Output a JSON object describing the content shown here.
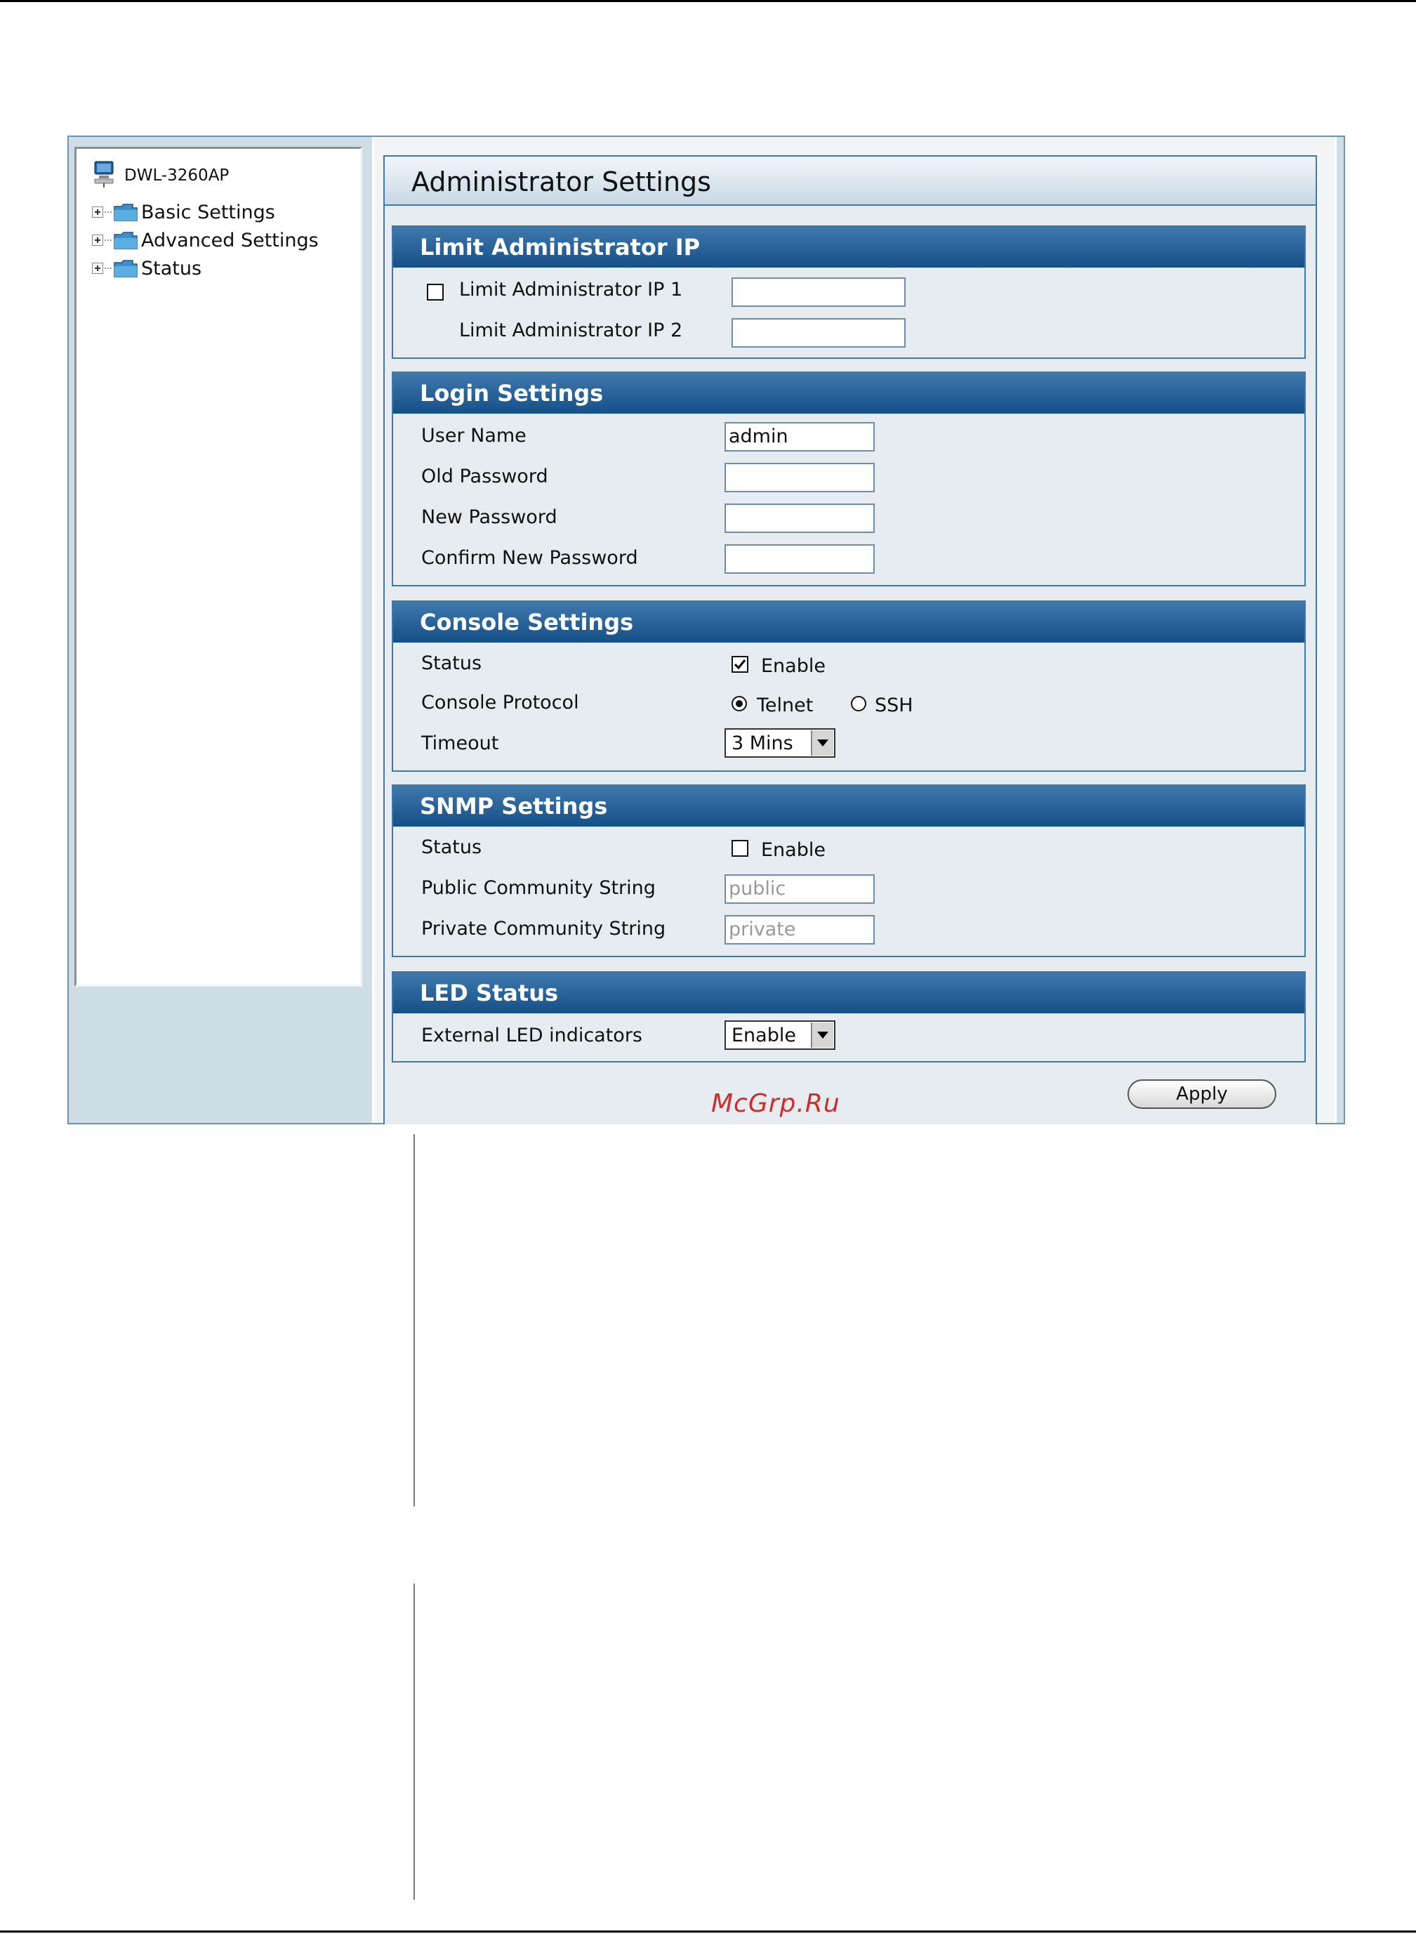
{
  "tree": {
    "root": "DWL-3260AP",
    "items": [
      {
        "label": "Basic Settings"
      },
      {
        "label": "Advanced Settings"
      },
      {
        "label": "Status"
      }
    ]
  },
  "page_title": "Administrator Settings",
  "limit_ip": {
    "heading": "Limit Administrator IP",
    "ip1_label": "Limit Administrator IP 1",
    "ip1_checked": false,
    "ip1_value": "",
    "ip2_label": "Limit Administrator IP 2",
    "ip2_value": ""
  },
  "login": {
    "heading": "Login Settings",
    "user_name_label": "User Name",
    "user_name_value": "admin",
    "old_password_label": "Old Password",
    "new_password_label": "New Password",
    "confirm_password_label": "Confirm New Password"
  },
  "console": {
    "heading": "Console Settings",
    "status_label": "Status",
    "status_enable_label": "Enable",
    "status_enabled": true,
    "protocol_label": "Console Protocol",
    "protocol_options": [
      "Telnet",
      "SSH"
    ],
    "protocol_selected": "Telnet",
    "timeout_label": "Timeout",
    "timeout_value": "3 Mins"
  },
  "snmp": {
    "heading": "SNMP Settings",
    "status_label": "Status",
    "status_enable_label": "Enable",
    "status_enabled": false,
    "public_label": "Public Community String",
    "public_value": "public",
    "private_label": "Private Community String",
    "private_value": "private"
  },
  "led": {
    "heading": "LED Status",
    "external_label": "External LED indicators",
    "external_value": "Enable"
  },
  "apply_label": "Apply",
  "watermark": "McGrp.Ru",
  "colors": {
    "section_header": "#1c5a94",
    "panel_background": "#e6ecef",
    "border": "#3f78a9",
    "watermark": "#cf2d2d"
  }
}
